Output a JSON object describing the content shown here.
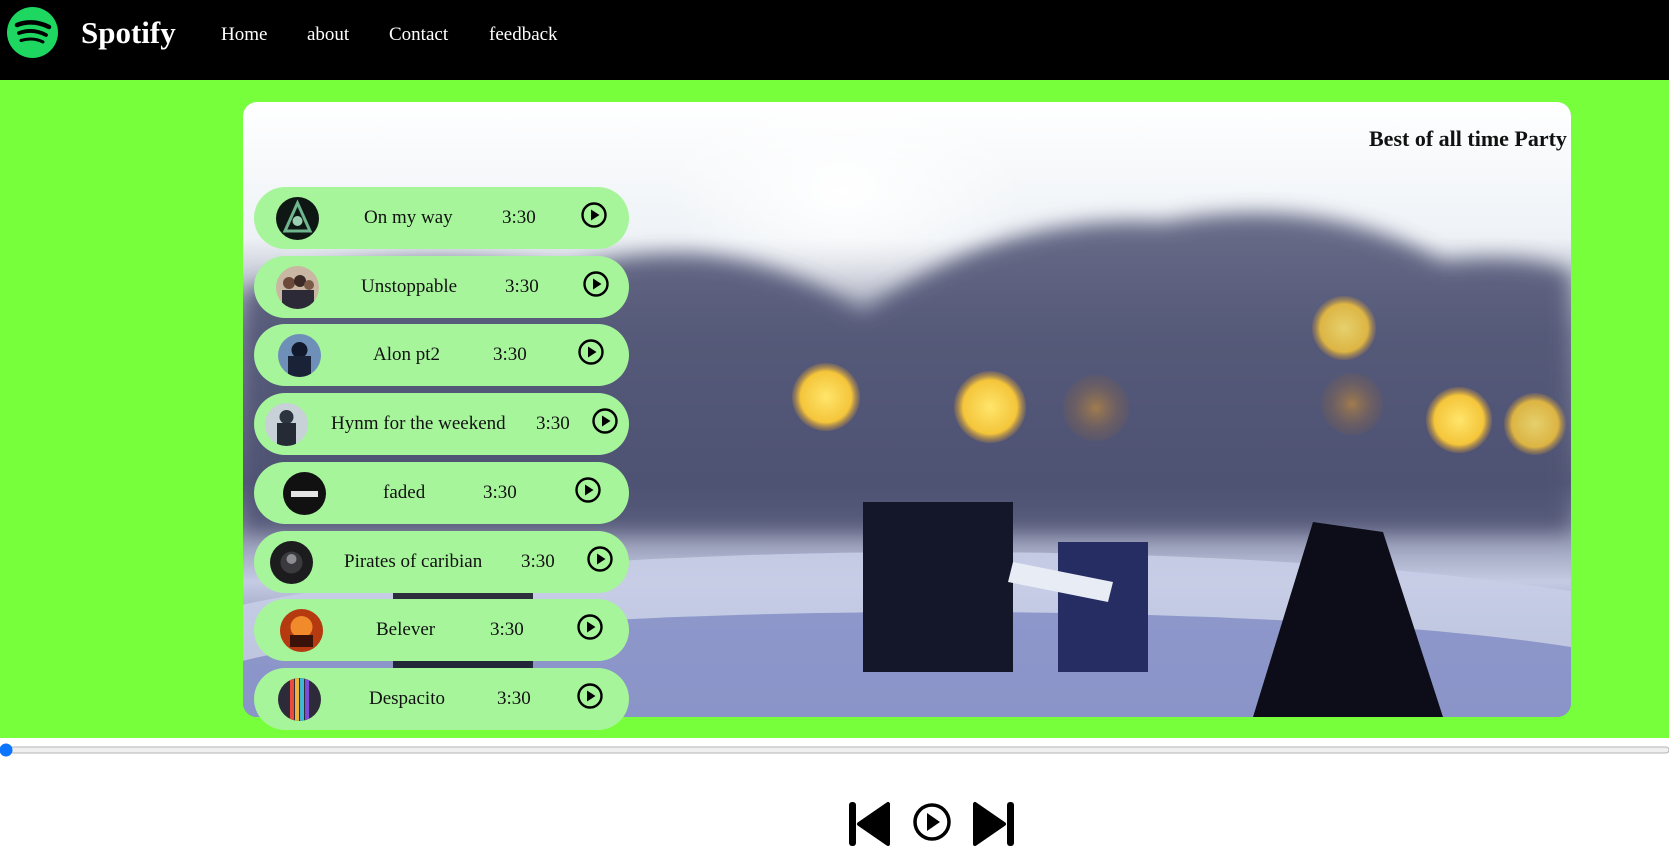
{
  "nav": {
    "brand": "Spotify",
    "links": [
      "Home",
      "about",
      "Contact",
      "feedback"
    ]
  },
  "hero": {
    "title": "Best of all time Party"
  },
  "songs": [
    {
      "name": "On my way",
      "duration": "3:30"
    },
    {
      "name": "Unstoppable",
      "duration": "3:30"
    },
    {
      "name": "Alon pt2",
      "duration": "3:30"
    },
    {
      "name": "Hynm for the weekend",
      "duration": "3:30"
    },
    {
      "name": "faded",
      "duration": "3:30"
    },
    {
      "name": "Pirates of caribian",
      "duration": "3:30"
    },
    {
      "name": "Belever",
      "duration": "3:30"
    },
    {
      "name": "Despacito",
      "duration": "3:30"
    }
  ],
  "player": {
    "progress": 0,
    "controls": [
      "previous-icon",
      "play-icon",
      "next-icon"
    ]
  },
  "colors": {
    "nav_bg": "#000000",
    "main_bg": "#76ff3a",
    "song_card": "#a6f59b",
    "logo": "#1ed760",
    "seek_thumb": "#0b75ff"
  }
}
